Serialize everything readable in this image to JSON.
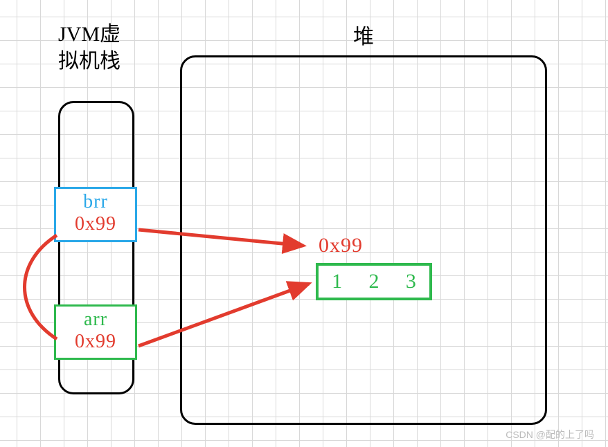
{
  "stack": {
    "title": "JVM虚\n拟机栈",
    "vars": {
      "brr": {
        "name": "brr",
        "address": "0x99"
      },
      "arr": {
        "name": "arr",
        "address": "0x99"
      }
    }
  },
  "heap": {
    "title": "堆",
    "object": {
      "address": "0x99",
      "contents": [
        "1",
        "2",
        "3"
      ]
    }
  },
  "colors": {
    "brr_border": "#2aa8e8",
    "arr_border": "#2eb94d",
    "address": "#e23b2e",
    "arrow": "#e23b2e"
  },
  "watermark": "CSDN @配的上了吗"
}
